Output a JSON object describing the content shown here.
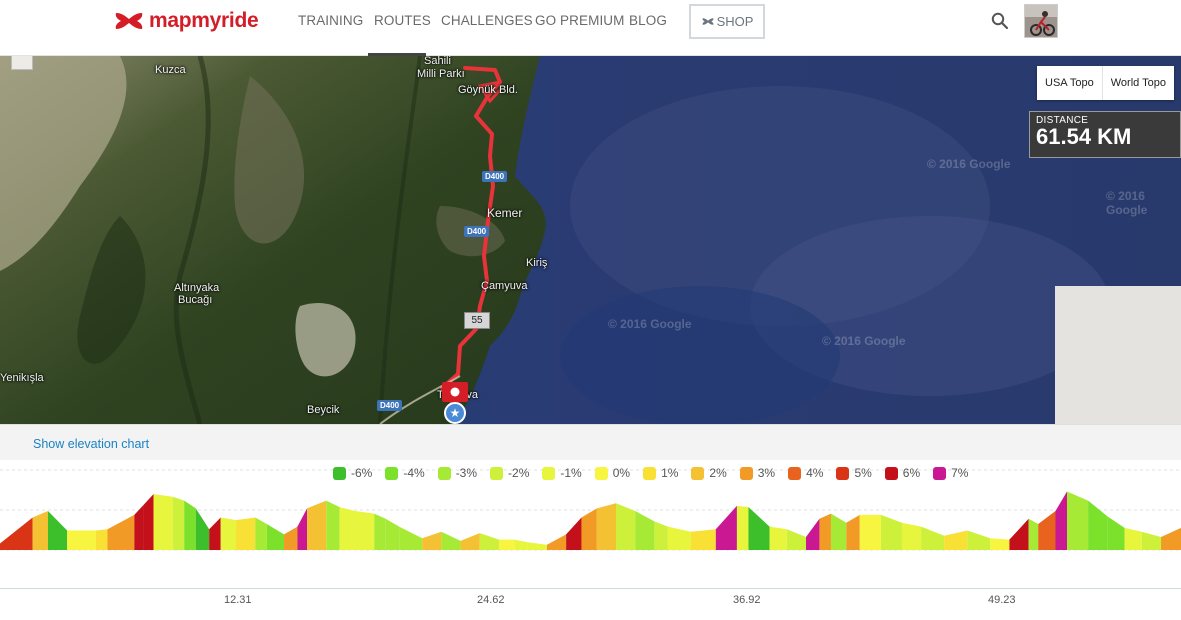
{
  "header": {
    "brand": "mapmyride",
    "nav": [
      "TRAINING",
      "ROUTES",
      "CHALLENGES",
      "GO PREMIUM",
      "BLOG"
    ],
    "shop_label": "SHOP",
    "active_nav": "ROUTES"
  },
  "map": {
    "labels": {
      "kuzca": "Kuzca",
      "park_1": "Sahili",
      "park_2": "Milli Parkı",
      "goynuk": "Göynük Bld.",
      "kemer": "Kemer",
      "kiris": "Kiriş",
      "camyuva": "Çamyuva",
      "altinyaka_1": "Altınyaka",
      "altinyaka_2": "Bucağı",
      "yenikisla": "Yenikışla",
      "beycik": "Beycik",
      "tekirova": "Tekirova"
    },
    "road_badges": [
      "D400",
      "D400",
      "D400"
    ],
    "watermarks": [
      "© 2016 Google",
      "© 2016 Google",
      "© 2016 Google",
      "© 2016 Google"
    ],
    "map_types": [
      "USA Topo",
      "World Topo"
    ],
    "distance_label": "DISTANCE",
    "distance_value": "61.54 KM",
    "km_marker": "55",
    "route_color": "#e8333b"
  },
  "elevation": {
    "toggle_label": "Show elevation chart",
    "legend": [
      {
        "label": "-6%",
        "color": "#3cbf2a"
      },
      {
        "label": "-4%",
        "color": "#7be12b"
      },
      {
        "label": "-3%",
        "color": "#a6ea35"
      },
      {
        "label": "-2%",
        "color": "#cdf03a"
      },
      {
        "label": "-1%",
        "color": "#e8f53d"
      },
      {
        "label": "0%",
        "color": "#f7f53f"
      },
      {
        "label": "1%",
        "color": "#f8e034"
      },
      {
        "label": "2%",
        "color": "#f3c131"
      },
      {
        "label": "3%",
        "color": "#f29a26"
      },
      {
        "label": "4%",
        "color": "#e8641e"
      },
      {
        "label": "5%",
        "color": "#d93415"
      },
      {
        "label": "6%",
        "color": "#c3101a"
      },
      {
        "label": "7%",
        "color": "#c91891"
      }
    ],
    "x_ticks": [
      "12.31",
      "24.62",
      "36.92",
      "49.23"
    ]
  },
  "chart_data": {
    "type": "area",
    "x_ticks": [
      12.31,
      24.62,
      36.92,
      49.23
    ],
    "xlim": [
      0,
      61.54
    ],
    "series": [
      {
        "x": [
          0,
          1.7,
          2.5,
          3.5,
          5,
          5.6,
          7,
          7.5,
          8,
          9,
          9.6,
          10.2,
          10.9,
          11.5,
          12.3,
          13.3,
          13.9,
          14.8,
          15.5,
          16,
          17,
          17.7,
          18.5,
          19.5,
          20.1,
          20.8,
          22,
          23,
          24,
          25,
          26,
          26.8,
          27.5,
          28.5,
          29.5,
          30.3,
          31.1,
          32.1,
          33.1,
          34.1,
          34.8,
          36,
          37.3,
          38.4,
          39,
          40.1,
          41,
          42,
          42.7,
          43.3,
          44.1,
          44.8,
          45.9,
          47,
          48,
          49.2,
          50.4,
          51.6,
          52.6,
          53.6,
          54.1,
          55,
          55.6,
          56.7,
          57.7,
          58.6,
          59.5,
          60.5,
          61.54
        ],
        "y": [
          0.5,
          2.5,
          3.0,
          1.5,
          1.5,
          1.6,
          2.7,
          3.5,
          4.3,
          4.1,
          3.8,
          3.2,
          1.6,
          2.5,
          2.3,
          2.5,
          2.0,
          1.2,
          1.8,
          3.2,
          3.8,
          3.3,
          3.0,
          2.8,
          2.4,
          1.8,
          0.9,
          1.4,
          0.7,
          1.3,
          0.8,
          0.8,
          0.6,
          0.4,
          1.2,
          2.5,
          3.2,
          3.6,
          3.0,
          2.2,
          1.8,
          1.4,
          1.6,
          3.4,
          3.3,
          1.8,
          1.6,
          1.0,
          2.4,
          2.8,
          2.1,
          2.7,
          2.7,
          2.1,
          1.8,
          1.1,
          1.5,
          0.9,
          0.8,
          2.4,
          2.0,
          3.0,
          4.5,
          3.8,
          2.6,
          1.7,
          1.4,
          1.0,
          1.7
        ]
      }
    ]
  }
}
